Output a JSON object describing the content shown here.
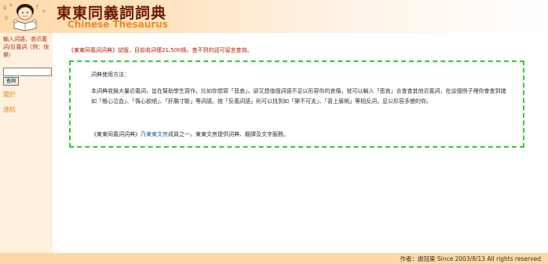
{
  "header": {
    "title": "東東同義詞詞典",
    "subtitle": "Chinese Thesaurus"
  },
  "sidebar": {
    "search_label": "輸入詞語，查近義詞/反義詞（例：快樂）",
    "search_value": "",
    "search_button": "查詞",
    "links": [
      "關於",
      "連結"
    ]
  },
  "main": {
    "notice": "《東東同義詞詞典》試版，目前收詞僅21,500條。查不到的話可留言查詢。",
    "usage_title": "詞典使用方法：",
    "usage_body": "本詞典收錄大量近義詞，旨在幫助學生寫作。比如你想寫「悲哀」，卻又想值個詞語不足以形容你的哀傷，就可以輸入「悲哀」去查查其他近義詞，在這個例子裡你會查到諸如「椎心泣血」、「傷心欲絕」、「肝腸寸斷」等詞語。按「反義詞語」則可以找到如「樂不可支」、「喜上眉梢」等相反詞，足以形容多變的你。",
    "footer_prefix": "《東東同義詞詞典》乃",
    "footer_link": "東東文房",
    "footer_suffix": "成員之一，東東文房提供詞典、翻譯及文字服務。"
  },
  "footer": {
    "text": "作者：謝冠東 Since 2003/8/13 All rights reserved"
  },
  "colors": {
    "header_orange": "#f08a20",
    "title_brown": "#6a1a00",
    "notice_red": "#b02000",
    "box_border_green": "#33cc33",
    "footer_bg": "#ffd7a6",
    "sidebar_bg": "#fff1e0"
  }
}
